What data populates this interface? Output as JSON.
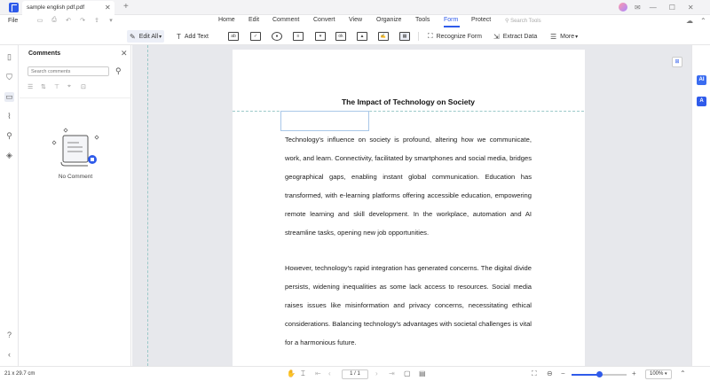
{
  "titlebar": {
    "tab_title": "sample english pdf.pdf",
    "tab_close_icon": "close-icon",
    "new_tab_label": "+",
    "icons": [
      "user-avatar-icon",
      "notification-icon",
      "minimize-icon",
      "maximize-icon",
      "close-window-icon"
    ]
  },
  "menu": {
    "file": "File",
    "quick_access": [
      "save-icon",
      "print-icon",
      "undo-icon",
      "redo-icon",
      "share-icon",
      "dropdown-icon"
    ],
    "tabs": [
      "Home",
      "Edit",
      "Comment",
      "Convert",
      "View",
      "Organize",
      "Tools",
      "Form",
      "Protect"
    ],
    "active_tab": "Form",
    "search_placeholder": "Search Tools",
    "right_icons": [
      "cloud-upload-icon",
      "help-icon",
      "chevron-up-icon"
    ]
  },
  "toolbar": {
    "edit_all": "Edit All",
    "add_text": "Add Text",
    "recognize_form": "Recognize Form",
    "extract_data": "Extract Data",
    "more": "More",
    "field_tools": [
      "text-field-icon",
      "checkbox-icon",
      "radio-button-icon",
      "list-box-icon",
      "dropdown-field-icon",
      "button-field-icon",
      "image-field-icon",
      "signature-field-icon",
      "date-field-icon"
    ]
  },
  "left_rail": [
    "page-icon",
    "bookmark-icon",
    "comment-icon",
    "attachment-icon",
    "search-icon",
    "layers-icon",
    "help-icon",
    "collapse-icon"
  ],
  "comments_panel": {
    "title": "Comments",
    "search_placeholder": "Search comments",
    "filters": [
      "list-view-icon",
      "sort-icon",
      "filter-icon",
      "type-filter-icon",
      "status-filter-icon"
    ],
    "empty_text": "No Comment"
  },
  "document": {
    "title": "The Impact of Technology on Society",
    "paragraph1": "Technology's influence on society is profound, altering how we communicate, work, and learn. Connectivity, facilitated by smartphones and social media, bridges geographical gaps, enabling instant global communication. Education has transformed, with e-learning platforms offering accessible education, empowering remote learning and skill development. In the workplace, automation and AI streamline tasks, opening new job opportunities.",
    "paragraph2": "However, technology's rapid integration has generated concerns. The digital divide persists, widening inequalities as some lack access to resources. Social media raises issues like misinformation and privacy concerns, necessitating ethical considerations. Balancing technology's advantages with societal challenges is vital for a harmonious future."
  },
  "right_rail": {
    "ai_badge": "AI",
    "translate_badge": "A"
  },
  "statusbar": {
    "page_size": "21 x 29.7 cm",
    "page_indicator": "1 / 1",
    "zoom_level": "100%",
    "zoom_fraction": 0.5,
    "accent": "#2f5bea"
  }
}
